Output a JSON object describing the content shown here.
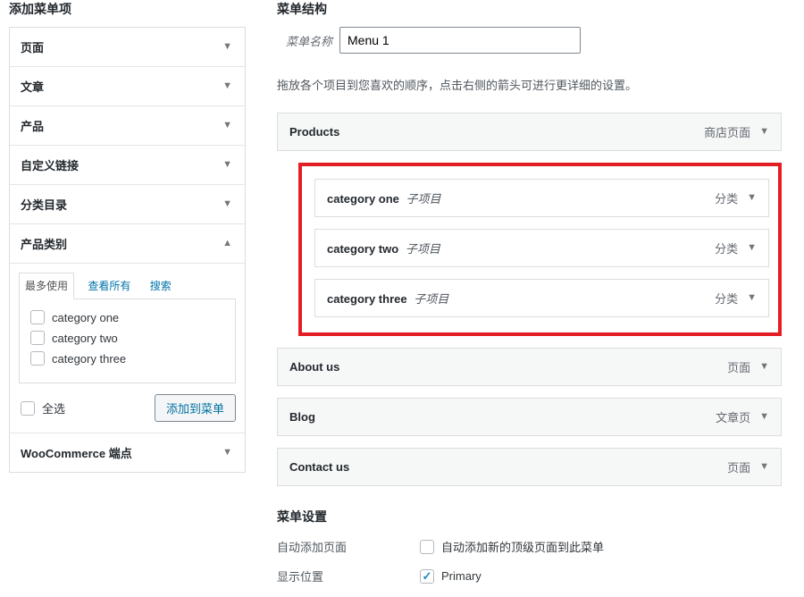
{
  "left": {
    "title": "添加菜单项",
    "sections": [
      {
        "label": "页面"
      },
      {
        "label": "文章"
      },
      {
        "label": "产品"
      },
      {
        "label": "自定义链接"
      },
      {
        "label": "分类目录"
      }
    ],
    "open_section_label": "产品类别",
    "tabs": {
      "most_used": "最多使用",
      "view_all": "查看所有",
      "search": "搜索"
    },
    "categories": [
      "category one",
      "category two",
      "category three"
    ],
    "select_all": "全选",
    "add_to_menu": "添加到菜单",
    "last_section_label": "WooCommerce 端点"
  },
  "right": {
    "title": "菜单结构",
    "menu_name_label": "菜单名称",
    "menu_name_value": "Menu 1",
    "instructions": "拖放各个项目到您喜欢的顺序，点击右侧的箭头可进行更详细的设置。",
    "items": {
      "products": {
        "label": "Products",
        "type": "商店页面"
      },
      "sub": [
        {
          "label": "category one",
          "type": "分类"
        },
        {
          "label": "category two",
          "type": "分类"
        },
        {
          "label": "category three",
          "type": "分类"
        }
      ],
      "subitem_text": "子项目",
      "about": {
        "label": "About us",
        "type": "页面"
      },
      "blog": {
        "label": "Blog",
        "type": "文章页"
      },
      "contact": {
        "label": "Contact us",
        "type": "页面"
      }
    },
    "settings": {
      "title": "菜单设置",
      "auto_add_label": "自动添加页面",
      "auto_add_text": "自动添加新的顶级页面到此菜单",
      "display_loc_label": "显示位置",
      "display_loc_text": "Primary"
    }
  }
}
